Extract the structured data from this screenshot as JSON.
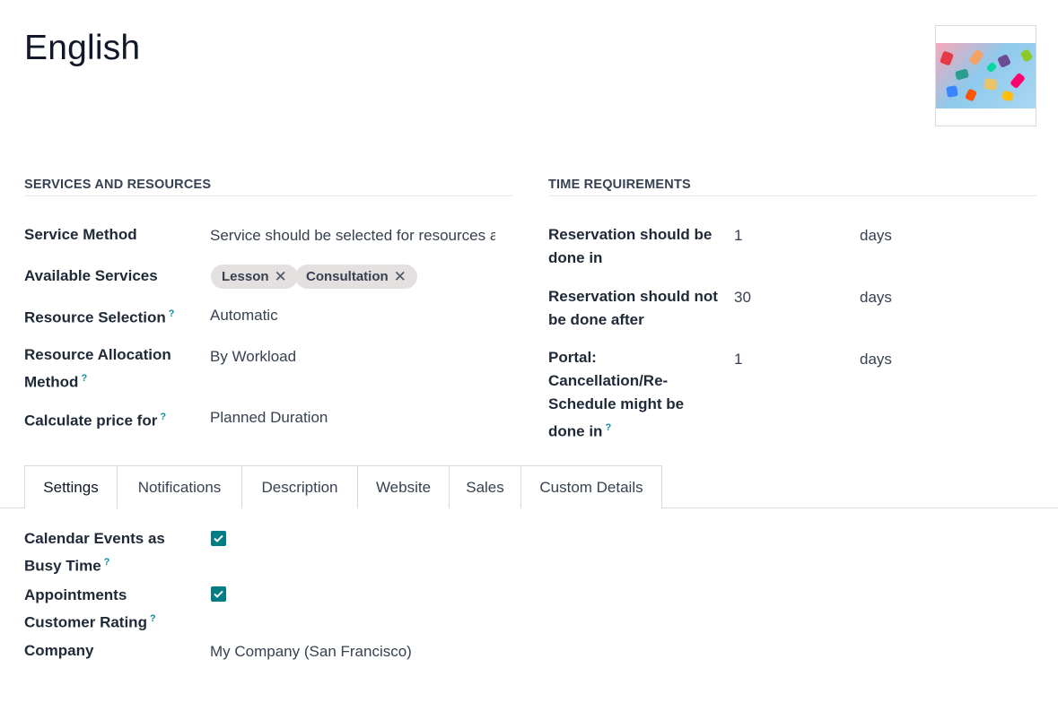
{
  "record": {
    "title": "English"
  },
  "sections": {
    "services": "SERVICES AND RESOURCES",
    "time": "TIME REQUIREMENTS"
  },
  "fields": {
    "service_method": {
      "label": "Service Method",
      "value": "Service should be selected for resources a"
    },
    "available_services": {
      "label": "Available Services",
      "tags": [
        "Lesson",
        "Consultation"
      ]
    },
    "resource_selection": {
      "label": "Resource Selection",
      "value": "Automatic"
    },
    "resource_allocation": {
      "label_line1": "Resource Allocation",
      "label_line2": "Method",
      "value": "By Workload"
    },
    "calculate_price": {
      "label": "Calculate price for",
      "value": "Planned Duration"
    }
  },
  "time_fields": {
    "min_notice": {
      "label_line1": "Reservation should be",
      "label_line2": "done in",
      "value": "1",
      "unit": "days"
    },
    "max_notice": {
      "label_line1": "Reservation should not",
      "label_line2": "be done after",
      "value": "30",
      "unit": "days"
    },
    "cancel_notice": {
      "label_line1": "Portal:",
      "label_line2": "Cancellation/Re-",
      "label_line3": "Schedule might be",
      "label_line4": "done in",
      "value": "1",
      "unit": "days"
    }
  },
  "help_mark": "?",
  "tabs": [
    "Settings",
    "Notifications",
    "Description",
    "Website",
    "Sales",
    "Custom Details"
  ],
  "settings": {
    "busy_time": {
      "label_line1": "Calendar Events as",
      "label_line2": "Busy Time",
      "checked": true
    },
    "customer_rating": {
      "label_line1": "Appointments",
      "label_line2": "Customer Rating",
      "checked": true
    },
    "company": {
      "label": "Company",
      "value": "My Company (San Francisco)"
    }
  },
  "colors": {
    "accent": "#017e84",
    "help": "#0f8c9c",
    "tag_bg": "#e5e0e0"
  }
}
